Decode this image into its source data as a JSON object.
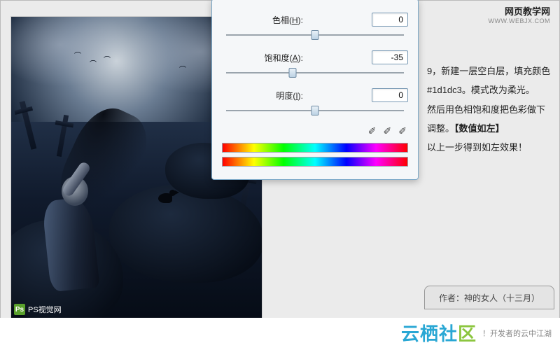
{
  "site": {
    "title": "网页教学网",
    "url": "WWW.WEBJX.COM"
  },
  "dialog": {
    "hue": {
      "label_pre": "色相(",
      "hotkey": "H",
      "label_post": "):",
      "value": "0",
      "pos": 50
    },
    "saturation": {
      "label_pre": "饱和度(",
      "hotkey": "A",
      "label_post": "):",
      "value": "-35",
      "pos": 38
    },
    "lightness": {
      "label_pre": "明度(",
      "hotkey": "I",
      "label_post": "):",
      "value": "0",
      "pos": 50
    }
  },
  "tutorial": {
    "line1": "9，新建一层空白层，填充颜色",
    "line2": "#1d1dc3。模式改为柔光。",
    "line3": "然后用色相饱和度把色彩做下",
    "line4_pre": "调整。",
    "line4_bold": "【数值如左】",
    "line5": "以上一步得到如左效果！"
  },
  "author": {
    "label": "作者：神的女人（十三月）"
  },
  "watermark_left": {
    "badge": "Ps",
    "text": "PS视觉网"
  },
  "footer": {
    "logo_main": "云栖社",
    "logo_accent": "区",
    "tagline": "！开发者的云中江湖"
  }
}
